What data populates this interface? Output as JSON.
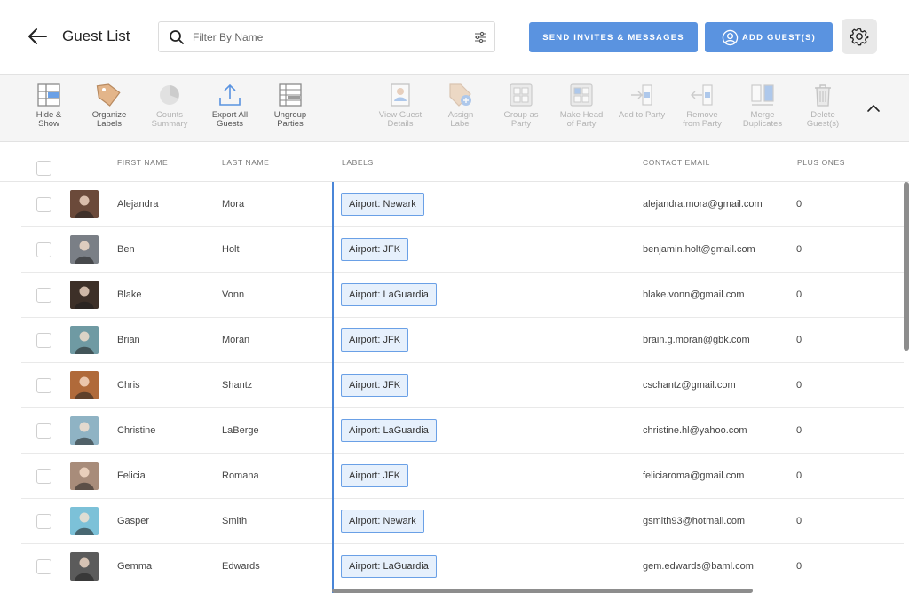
{
  "header": {
    "title": "Guest List",
    "filter_placeholder": "Filter By Name",
    "send_label": "SEND INVITES & MESSAGES",
    "add_label": "ADD GUEST(S)"
  },
  "toolbar": {
    "items": [
      {
        "label": "Hide &\nShow",
        "icon": "columns-icon",
        "enabled": true
      },
      {
        "label": "Organize\nLabels",
        "icon": "tag-icon",
        "enabled": true
      },
      {
        "label": "Counts\nSummary",
        "icon": "pie-chart-icon",
        "enabled": false
      },
      {
        "label": "Export All\nGuests",
        "icon": "upload-icon",
        "enabled": true
      },
      {
        "label": "Ungroup\nParties",
        "icon": "ungroup-icon",
        "enabled": true
      },
      {
        "label": "View Guest\nDetails",
        "icon": "profile-card-icon",
        "enabled": false
      },
      {
        "label": "Assign\nLabel",
        "icon": "tag-plus-icon",
        "enabled": false
      },
      {
        "label": "Group as\nParty",
        "icon": "grid-icon",
        "enabled": false
      },
      {
        "label": "Make Head\nof Party",
        "icon": "grid-head-icon",
        "enabled": false
      },
      {
        "label": "Add to Party",
        "icon": "arrow-into-icon",
        "enabled": false
      },
      {
        "label": "Remove\nfrom Party",
        "icon": "arrow-out-icon",
        "enabled": false
      },
      {
        "label": "Merge\nDuplicates",
        "icon": "merge-icon",
        "enabled": false
      },
      {
        "label": "Delete\nGuest(s)",
        "icon": "trash-icon",
        "enabled": false
      }
    ]
  },
  "table": {
    "columns": [
      "FIRST NAME",
      "LAST NAME",
      "LABELS",
      "CONTACT EMAIL",
      "PLUS ONES"
    ],
    "rows": [
      {
        "first": "Alejandra",
        "last": "Mora",
        "label": "Airport: Newark",
        "email": "alejandra.mora@gmail.com",
        "plus": "0"
      },
      {
        "first": "Ben",
        "last": "Holt",
        "label": "Airport: JFK",
        "email": "benjamin.holt@gmail.com",
        "plus": "0"
      },
      {
        "first": "Blake",
        "last": "Vonn",
        "label": "Airport: LaGuardia",
        "email": "blake.vonn@gmail.com",
        "plus": "0"
      },
      {
        "first": "Brian",
        "last": "Moran",
        "label": "Airport: JFK",
        "email": "brain.g.moran@gbk.com",
        "plus": "0"
      },
      {
        "first": "Chris",
        "last": "Shantz",
        "label": "Airport: JFK",
        "email": "cschantz@gmail.com",
        "plus": "0"
      },
      {
        "first": "Christine",
        "last": "LaBerge",
        "label": "Airport: LaGuardia",
        "email": "christine.hl@yahoo.com",
        "plus": "0"
      },
      {
        "first": "Felicia",
        "last": "Romana",
        "label": "Airport: JFK",
        "email": "feliciaroma@gmail.com",
        "plus": "0"
      },
      {
        "first": "Gasper",
        "last": "Smith",
        "label": "Airport: Newark",
        "email": "gsmith93@hotmail.com",
        "plus": "0"
      },
      {
        "first": "Gemma",
        "last": "Edwards",
        "label": "Airport: LaGuardia",
        "email": "gem.edwards@baml.com",
        "plus": "0"
      }
    ]
  },
  "colors": {
    "accent": "#5a93e0",
    "chip_border": "#6aa0e6",
    "chip_bg": "#e6f0fc",
    "avatars": [
      "#6b4a3a",
      "#7a7f86",
      "#3d3028",
      "#6f9aa3",
      "#b06a3a",
      "#8fb3c4",
      "#a88c7a",
      "#7cc1d8",
      "#5b5b5b"
    ]
  }
}
